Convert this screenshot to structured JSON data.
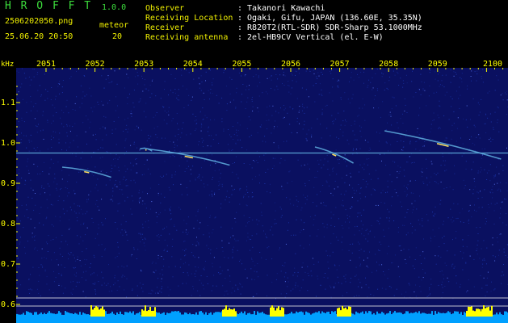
{
  "header": {
    "app_name": "H R O F F T",
    "version": "1.0.0",
    "filename": "2506202050.png",
    "datetime": "25.06.20 20:50",
    "meteor_label": "meteor",
    "meteor_count": "20",
    "fields": [
      {
        "label": "Observer",
        "value": ": Takanori Kawachi"
      },
      {
        "label": "Receiving Location",
        "value": ": Ogaki, Gifu, JAPAN (136.60E, 35.35N)"
      },
      {
        "label": "Receiver",
        "value": ": R820T2(RTL-SDR) SDR-Sharp 53.1000MHz"
      },
      {
        "label": "Receiving antenna",
        "value": ": 2el-HB9CV Vertical (el. E-W)"
      }
    ]
  },
  "spectrogram": {
    "y_unit": "kHz",
    "y_ticks": [
      "1.1",
      "1.0",
      "0.9",
      "0.8",
      "0.7",
      "0.6"
    ],
    "x_ticks": [
      "2051",
      "2052",
      "2053",
      "2054",
      "2055",
      "2056",
      "2057",
      "2058",
      "2059",
      "2100"
    ],
    "colors": {
      "background": "#0a1060",
      "noise": "#2040c0",
      "carrier": "#60b0e0",
      "echo": "#ffe060",
      "baseline": "#00a0ff",
      "burst": "#ffff00",
      "ticks": "#ffff00"
    }
  },
  "chart_data": {
    "type": "heatmap",
    "xlabel": "",
    "ylabel": "kHz",
    "x_categories": [
      "2051",
      "2052",
      "2053",
      "2054",
      "2055",
      "2056",
      "2057",
      "2058",
      "2059",
      "2100"
    ],
    "ylim": [
      0.58,
      1.15
    ],
    "carrier_khz": 0.975,
    "traces": [
      {
        "start": [
          "2051",
          0.94
        ],
        "end": [
          "2052",
          0.915
        ]
      },
      {
        "start": [
          "2053",
          0.985
        ],
        "end": [
          "2053",
          0.98
        ]
      },
      {
        "start": [
          "2053",
          0.985
        ],
        "end": [
          "2055",
          0.945
        ]
      },
      {
        "start": [
          "2056",
          0.99
        ],
        "end": [
          "2057",
          0.95
        ]
      },
      {
        "start": [
          "2058",
          1.03
        ],
        "end": [
          "2100",
          0.96
        ]
      }
    ]
  }
}
